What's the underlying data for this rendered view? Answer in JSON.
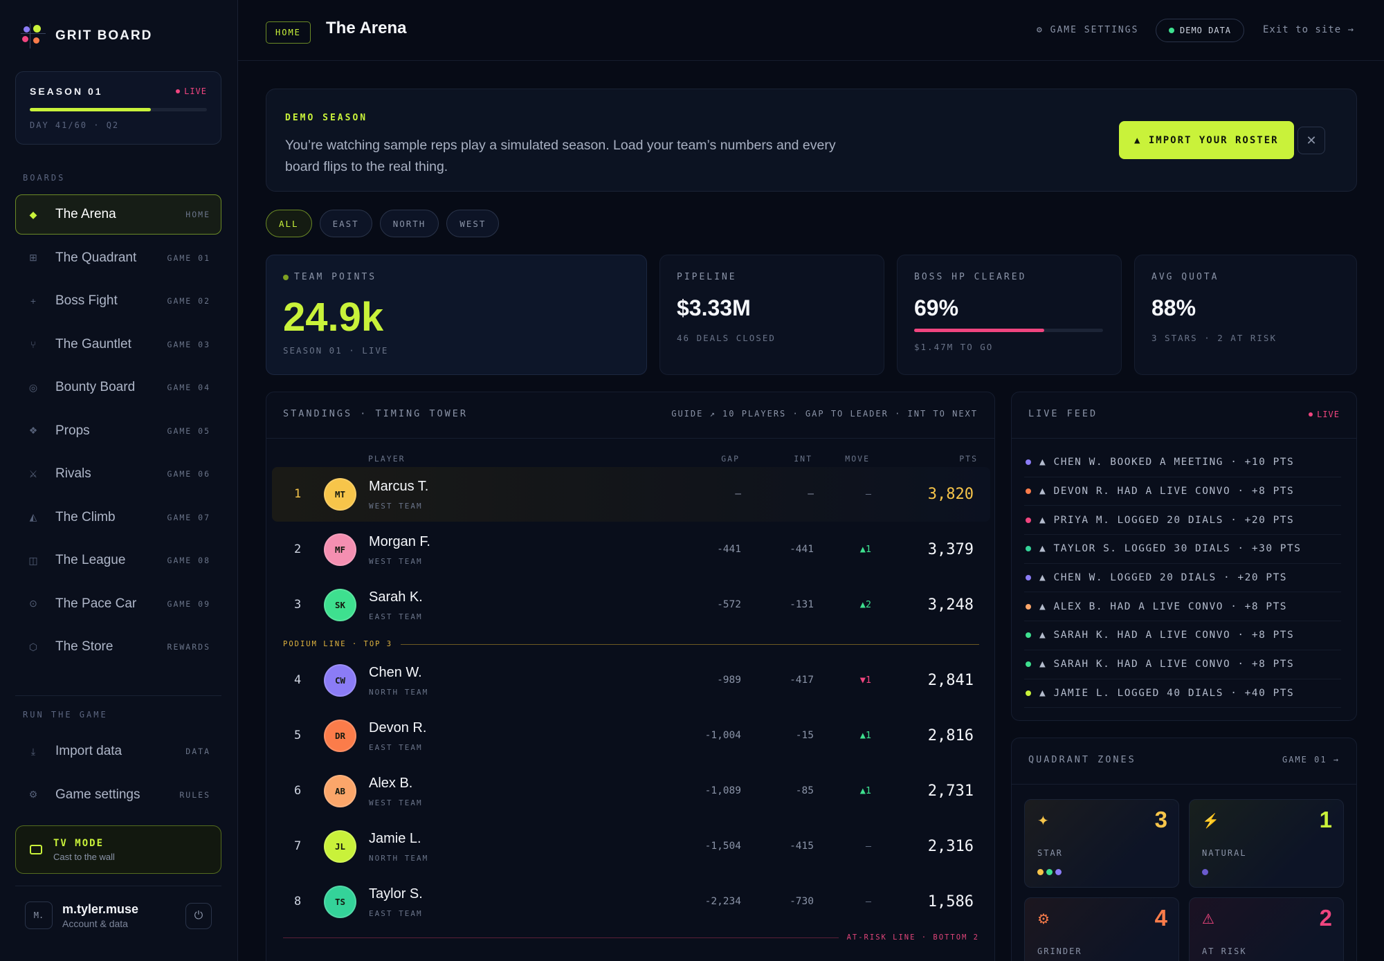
{
  "brand": {
    "name": "GRIT BOARD"
  },
  "season": {
    "title": "SEASON 01",
    "live": "LIVE",
    "progress": 0.683,
    "day": "DAY 41/60 · Q2"
  },
  "sidebar": {
    "boards_label": "BOARDS",
    "items": [
      {
        "label": "The Arena",
        "tag": "HOME",
        "icon": "diamond-icon",
        "glyph": "◆",
        "active": true
      },
      {
        "label": "The Quadrant",
        "tag": "GAME 01",
        "icon": "grid-icon",
        "glyph": "⊞"
      },
      {
        "label": "Boss Fight",
        "tag": "GAME 02",
        "icon": "crosshair-icon",
        "glyph": "+"
      },
      {
        "label": "The Gauntlet",
        "tag": "GAME 03",
        "icon": "fork-icon",
        "glyph": "⑂"
      },
      {
        "label": "Bounty Board",
        "tag": "GAME 04",
        "icon": "target-icon",
        "glyph": "◎"
      },
      {
        "label": "Props",
        "tag": "GAME 05",
        "icon": "sparkle-icon",
        "glyph": "❖"
      },
      {
        "label": "Rivals",
        "tag": "GAME 06",
        "icon": "swords-icon",
        "glyph": "⚔"
      },
      {
        "label": "The Climb",
        "tag": "GAME 07",
        "icon": "mountain-icon",
        "glyph": "◭"
      },
      {
        "label": "The League",
        "tag": "GAME 08",
        "icon": "columns-icon",
        "glyph": "◫"
      },
      {
        "label": "The Pace Car",
        "tag": "GAME 09",
        "icon": "gauge-icon",
        "glyph": "⊙"
      },
      {
        "label": "The Store",
        "tag": "REWARDS",
        "icon": "hexagon-icon",
        "glyph": "⬡"
      }
    ],
    "run_label": "RUN THE GAME",
    "run_items": [
      {
        "label": "Import data",
        "tag": "DATA",
        "icon": "download-icon",
        "glyph": "⤓"
      },
      {
        "label": "Game settings",
        "tag": "RULES",
        "icon": "gear-icon",
        "glyph": "⚙"
      }
    ],
    "tv": {
      "title": "TV MODE",
      "sub": "Cast to the wall"
    },
    "user": {
      "initial": "M.",
      "name": "m.tyler.muse",
      "sub": "Account & data"
    }
  },
  "topbar": {
    "home": "HOME",
    "title": "The Arena",
    "settings": "⚙ GAME SETTINGS",
    "demo": "DEMO DATA",
    "exit": "Exit to site →"
  },
  "banner": {
    "label": "DEMO SEASON",
    "text": "You’re watching sample reps play a simulated season. Load your team’s numbers and every board flips to the real thing.",
    "button": "▲ IMPORT YOUR ROSTER",
    "close": "✕"
  },
  "filters": [
    "ALL",
    "EAST",
    "NORTH",
    "WEST"
  ],
  "stats": [
    {
      "label": "TEAM POINTS",
      "value": "24.9k",
      "sub": "SEASON 01 · LIVE"
    },
    {
      "label": "PIPELINE",
      "value": "$3.33M",
      "sub": "46 DEALS CLOSED"
    },
    {
      "label": "BOSS HP CLEARED",
      "value": "69%",
      "sub": "$1.47M TO GO",
      "progress": 0.69
    },
    {
      "label": "AVG QUOTA",
      "value": "88%",
      "sub": "3 STARS · 2 AT RISK"
    }
  ],
  "standings": {
    "title": "STANDINGS · TIMING TOWER",
    "meta": "GUIDE ↗  10 PLAYERS · GAP TO LEADER · INT TO NEXT",
    "columns": {
      "player": "PLAYER",
      "gap": "GAP",
      "int": "INT",
      "move": "MOVE",
      "pts": "PTS"
    },
    "podium": "PODIUM LINE · TOP 3",
    "atrisk": "AT-RISK LINE · BOTTOM 2",
    "rows": [
      {
        "rank": "1",
        "initials": "MT",
        "name": "Marcus T.",
        "team": "WEST TEAM",
        "gap": "—",
        "int": "—",
        "move": "—",
        "dir": "none",
        "pts": "3,820",
        "color": "#f7c54a"
      },
      {
        "rank": "2",
        "initials": "MF",
        "name": "Morgan F.",
        "team": "WEST TEAM",
        "gap": "-441",
        "int": "-441",
        "move": "▲1",
        "dir": "up",
        "pts": "3,379",
        "color": "#f48fb1"
      },
      {
        "rank": "3",
        "initials": "SK",
        "name": "Sarah K.",
        "team": "EAST TEAM",
        "gap": "-572",
        "int": "-131",
        "move": "▲2",
        "dir": "up",
        "pts": "3,248",
        "color": "#3ee08f"
      },
      {
        "rank": "4",
        "initials": "CW",
        "name": "Chen W.",
        "team": "NORTH TEAM",
        "gap": "-989",
        "int": "-417",
        "move": "▼1",
        "dir": "down",
        "pts": "2,841",
        "color": "#8b7cf6"
      },
      {
        "rank": "5",
        "initials": "DR",
        "name": "Devon R.",
        "team": "EAST TEAM",
        "gap": "-1,004",
        "int": "-15",
        "move": "▲1",
        "dir": "up",
        "pts": "2,816",
        "color": "#fb7c4a"
      },
      {
        "rank": "6",
        "initials": "AB",
        "name": "Alex B.",
        "team": "WEST TEAM",
        "gap": "-1,089",
        "int": "-85",
        "move": "▲1",
        "dir": "up",
        "pts": "2,731",
        "color": "#fba66a"
      },
      {
        "rank": "7",
        "initials": "JL",
        "name": "Jamie L.",
        "team": "NORTH TEAM",
        "gap": "-1,504",
        "int": "-415",
        "move": "—",
        "dir": "none",
        "pts": "2,316",
        "color": "#c9f23a"
      },
      {
        "rank": "8",
        "initials": "TS",
        "name": "Taylor S.",
        "team": "EAST TEAM",
        "gap": "-2,234",
        "int": "-730",
        "move": "—",
        "dir": "none",
        "pts": "1,586",
        "color": "#34d399"
      }
    ]
  },
  "feed": {
    "title": "LIVE FEED",
    "live": "LIVE",
    "items": [
      {
        "text": "▲ CHEN W. BOOKED A MEETING · +10 PTS",
        "color": "#8b7cf6"
      },
      {
        "text": "▲ DEVON R. HAD A LIVE CONVO · +8 PTS",
        "color": "#fb7c4a"
      },
      {
        "text": "▲ PRIYA M. LOGGED 20 DIALS · +20 PTS",
        "color": "#f0457f"
      },
      {
        "text": "▲ TAYLOR S. LOGGED 30 DIALS · +30 PTS",
        "color": "#34d399"
      },
      {
        "text": "▲ CHEN W. LOGGED 20 DIALS · +20 PTS",
        "color": "#8b7cf6"
      },
      {
        "text": "▲ ALEX B. HAD A LIVE CONVO · +8 PTS",
        "color": "#fba66a"
      },
      {
        "text": "▲ SARAH K. HAD A LIVE CONVO · +8 PTS",
        "color": "#3ee08f"
      },
      {
        "text": "▲ SARAH K. HAD A LIVE CONVO · +8 PTS",
        "color": "#3ee08f"
      },
      {
        "text": "▲ JAMIE L. LOGGED 40 DIALS · +40 PTS",
        "color": "#c9f23a"
      }
    ]
  },
  "zones": {
    "title": "QUADRANT ZONES",
    "link": "GAME 01 →",
    "items": [
      {
        "label": "STAR",
        "count": "3",
        "icon": "star-icon",
        "glyph": "✦",
        "color": "#f7c54a",
        "dots": [
          "#f7c54a",
          "#3ee08f",
          "#8b7cf6"
        ]
      },
      {
        "label": "NATURAL",
        "count": "1",
        "icon": "bolt-icon",
        "glyph": "⚡",
        "color": "#c9f23a",
        "dots": [
          "#6a5acd"
        ]
      },
      {
        "label": "GRINDER",
        "count": "4",
        "icon": "gear-icon",
        "glyph": "⚙",
        "color": "#fb7c4a",
        "dots": []
      },
      {
        "label": "AT RISK",
        "count": "2",
        "icon": "warning-icon",
        "glyph": "⚠",
        "color": "#f0457f",
        "dots": []
      }
    ]
  }
}
